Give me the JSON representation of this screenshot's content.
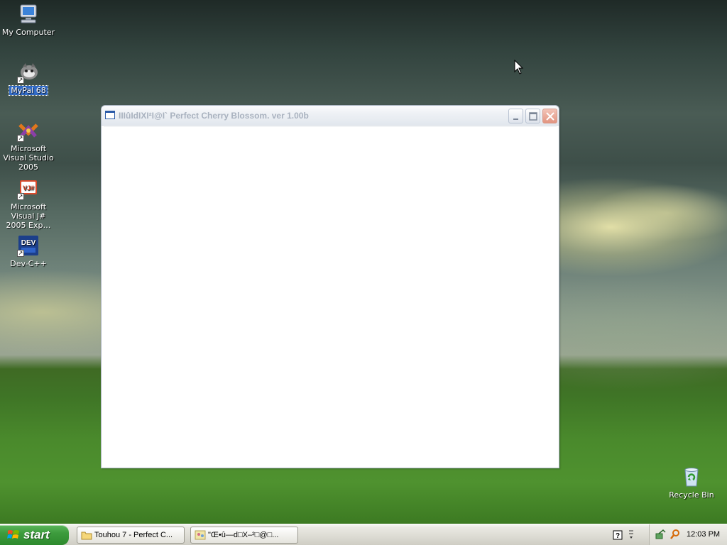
{
  "desktop": {
    "icons": [
      {
        "label": "My Computer",
        "icon": "my-computer-icon"
      },
      {
        "label": "MyPal 68",
        "icon": "mypal-browser-icon"
      },
      {
        "label": "Microsoft Visual Studio 2005",
        "icon": "visual-studio-icon"
      },
      {
        "label": "Microsoft Visual J# 2005 Exp…",
        "icon": "visual-jsharp-icon",
        "badge": "VJ#"
      },
      {
        "label": "Dev-C++",
        "icon": "dev-cpp-icon",
        "badge": "DEV"
      },
      {
        "label": "Recycle Bin",
        "icon": "recycle-bin-icon"
      }
    ]
  },
  "window": {
    "title": "IIIûIdIXI²I@I` Perfect Cherry Blossom. ver 1.00b",
    "buttons": {
      "minimize": "minimize",
      "maximize": "maximize",
      "close": "close"
    }
  },
  "taskbar": {
    "start_label": "start",
    "tasks": [
      {
        "label": "Touhou 7 - Perfect C...",
        "icon": "folder-icon"
      },
      {
        "label": "\"Œ•û—d□X–²□@□...",
        "icon": "game-icon"
      }
    ],
    "clock": "12:03 PM"
  },
  "colors": {
    "start_green": "#3d9b3d",
    "title_text": "#a9b2bf",
    "selection_blue": "#316ac5"
  }
}
